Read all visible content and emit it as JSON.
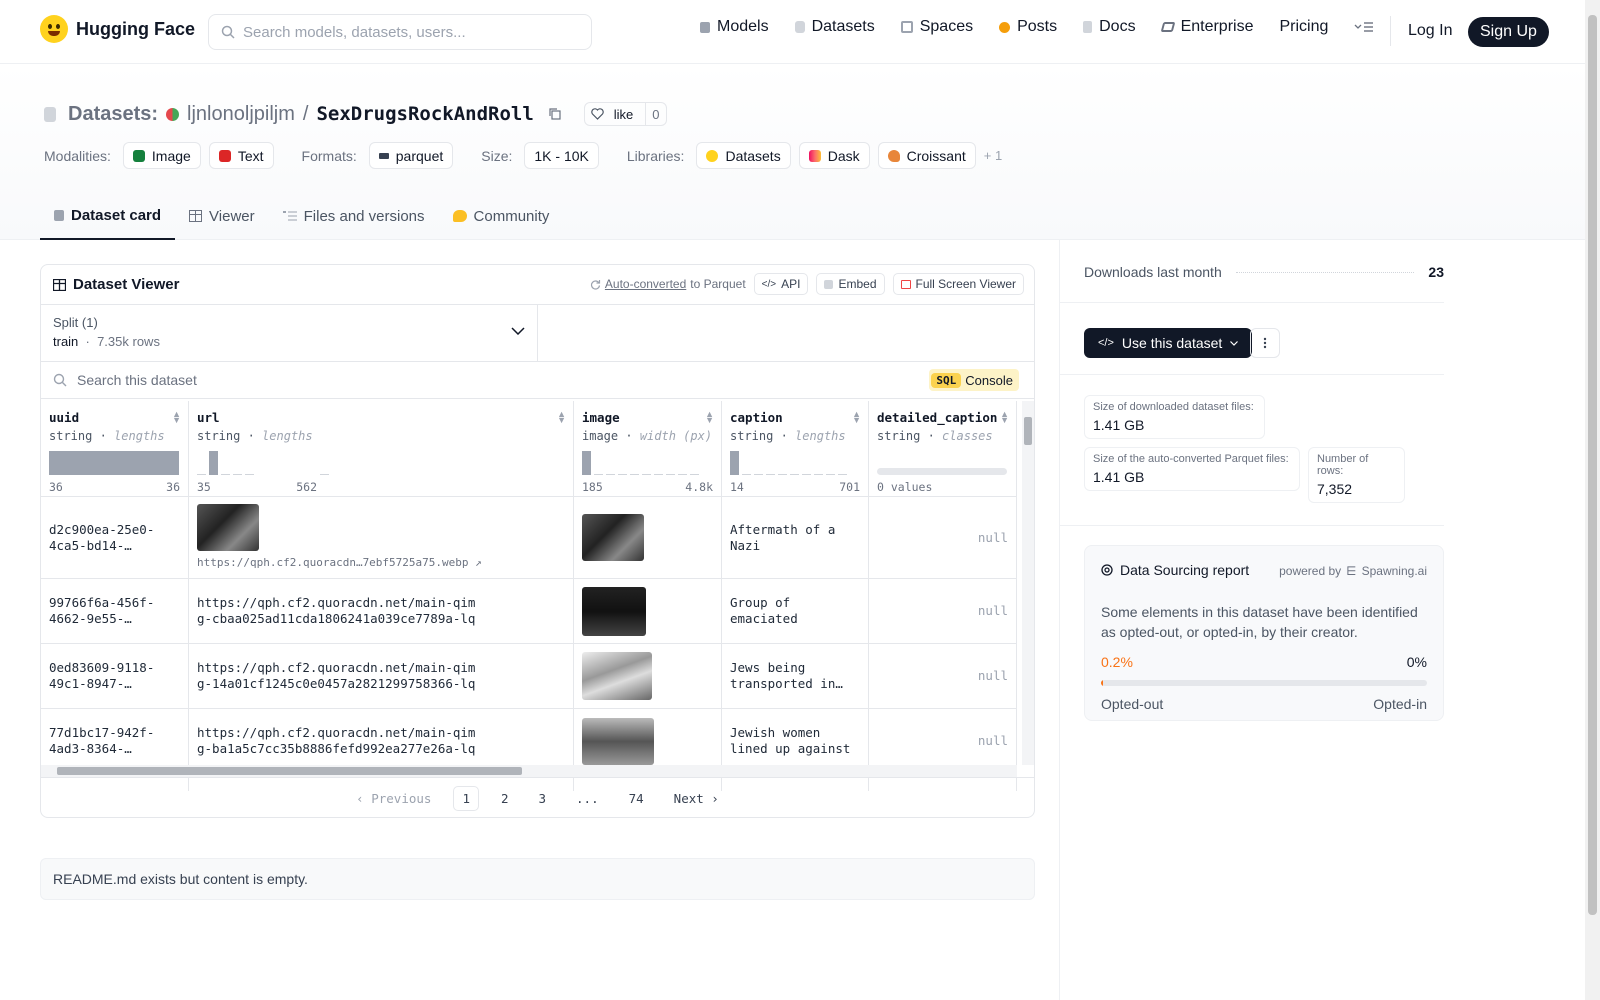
{
  "nav": {
    "brand": "Hugging Face",
    "search_placeholder": "Search models, datasets, users...",
    "links": [
      "Models",
      "Datasets",
      "Spaces",
      "Posts",
      "Docs",
      "Enterprise",
      "Pricing"
    ],
    "login": "Log In",
    "signup": "Sign Up"
  },
  "header": {
    "datasets_label": "Datasets:",
    "owner": "ljnlonoljpiljm",
    "sep": "/",
    "dataset_name": "SexDrugsRockAndRoll",
    "like_label": "like",
    "like_count": "0",
    "modalities_label": "Modalities:",
    "modalities": [
      "Image",
      "Text"
    ],
    "formats_label": "Formats:",
    "format": "parquet",
    "size_label": "Size:",
    "size": "1K - 10K",
    "libraries_label": "Libraries:",
    "libraries": [
      "Datasets",
      "Dask",
      "Croissant"
    ],
    "more_libraries": "+ 1"
  },
  "tabs": [
    "Dataset card",
    "Viewer",
    "Files and versions",
    "Community"
  ],
  "viewer": {
    "title": "Dataset Viewer",
    "auto_converted": "Auto-converted",
    "to_parquet": "to Parquet",
    "api": "API",
    "embed": "Embed",
    "fullscreen": "Full Screen Viewer",
    "split_label": "Split (1)",
    "split_name": "train",
    "split_rows": "7.35k rows",
    "search_placeholder": "Search this dataset",
    "sql_tag": "SQL",
    "console": "Console",
    "columns": [
      {
        "name": "uuid",
        "type": "string",
        "stat": "lengths",
        "min": "36",
        "max": "36"
      },
      {
        "name": "url",
        "type": "string",
        "stat": "lengths",
        "min": "35",
        "max": "562"
      },
      {
        "name": "image",
        "type": "image",
        "stat": "width (px)",
        "min": "185",
        "max": "4.8k"
      },
      {
        "name": "caption",
        "type": "string",
        "stat": "lengths",
        "min": "14",
        "max": "701"
      },
      {
        "name": "detailed_caption",
        "type": "string",
        "stat": "classes",
        "min": "0 values",
        "max": ""
      }
    ],
    "rows": [
      {
        "uuid": "d2c900ea-25e0-4ca5-bd14-…",
        "url": "https://qph.cf2.quoracdn…7ebf5725a75.webp",
        "caption": "Aftermath of a Nazi concentratio…",
        "detailed": "null"
      },
      {
        "uuid": "99766f6a-456f-4662-9e55-…",
        "url": "https://qph.cf2.quoracdn.net/main-qimg-cbaa025ad11cda1806241a039ce7789a-lq",
        "caption": "Group of emaciated prisoners standin…",
        "detailed": "null"
      },
      {
        "uuid": "0ed83609-9118-49c1-8947-…",
        "url": "https://qph.cf2.quoracdn.net/main-qimg-14a01cf1245c0e0457a2821299758366-lq",
        "caption": "Jews being transported in…",
        "detailed": "null"
      },
      {
        "uuid": "77d1bc17-942f-4ad3-8364-…",
        "url": "https://qph.cf2.quoracdn.net/main-qimg-ba1a5c7cc35b8886fefd992ea277e26a-lq",
        "caption": "Jewish women lined up against a wall…",
        "detailed": "null"
      }
    ],
    "pager": {
      "prev": "Previous",
      "pages": [
        "1",
        "2",
        "3",
        "...",
        "74"
      ],
      "next": "Next"
    }
  },
  "readme": "README.md exists but content is empty.",
  "sidebar": {
    "downloads_label": "Downloads last month",
    "downloads": "23",
    "use_dataset": "Use this dataset",
    "size_dl_label": "Size of downloaded dataset files:",
    "size_dl": "1.41 GB",
    "size_parquet_label": "Size of the auto-converted Parquet files:",
    "size_parquet": "1.41 GB",
    "rows_label": "Number of rows:",
    "rows": "7,352",
    "report_title": "Data Sourcing report",
    "powered_by": "powered by",
    "spawning": "Spawning.ai",
    "report_text": "Some elements in this dataset have been identified as opted-out, or opted-in, by their creator.",
    "opted_out_pct": "0.2%",
    "opted_in_pct": "0%",
    "opted_out_fraction": 0.002,
    "opted_out_label": "Opted-out",
    "opted_in_label": "Opted-in"
  }
}
